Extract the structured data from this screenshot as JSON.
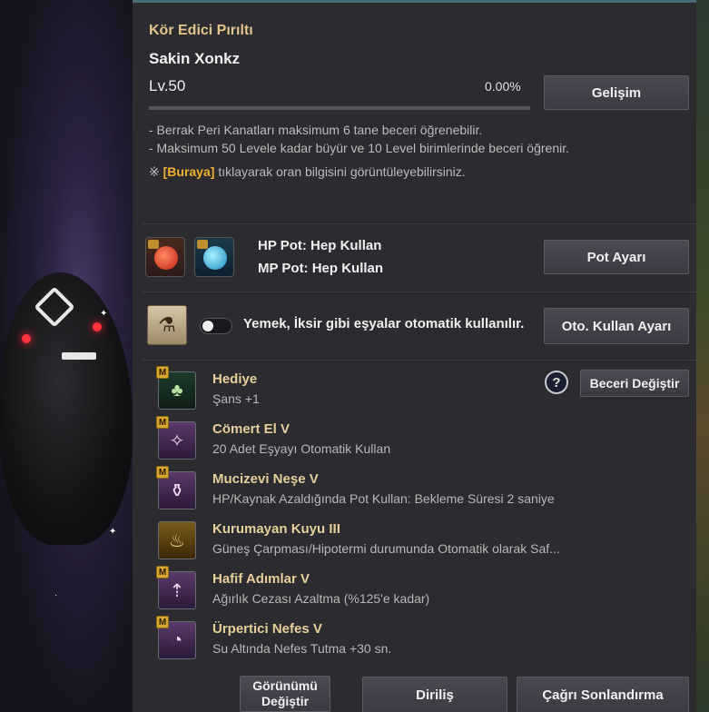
{
  "header": {
    "title": "Kör Edici Pırıltı",
    "pet_name": "Sakin Xonkz",
    "level": "Lv.50",
    "percent": "0.00%",
    "upgrade_button": "Gelişim",
    "xp_progress": 0
  },
  "info": {
    "line1": "- Berrak Peri Kanatları maksimum 6 tane beceri öğrenebilir.",
    "line2": "- Maksimum 50 Levele kadar büyür ve 10 Level birimlerinde beceri öğrenir.",
    "line3_prefix": "※",
    "line3_link": "[Buraya]",
    "line3_suffix": "tıklayarak oran bilgisini görüntüleyebilirsiniz."
  },
  "potions": {
    "hp_label": "HP Pot: Hep Kullan",
    "mp_label": "MP Pot: Hep Kullan",
    "settings_button": "Pot Ayarı"
  },
  "auto_use": {
    "text": "Yemek, İksir gibi eşyalar otomatik kullanılır.",
    "settings_button": "Oto. Kullan Ayarı",
    "toggle_on": false
  },
  "skills": {
    "help_label": "?",
    "change_button": "Beceri Değiştir",
    "items": [
      {
        "name": "Hediye",
        "desc": "Şans +1",
        "badge": "M",
        "icon": "clover-icon"
      },
      {
        "name": "Cömert El V",
        "desc": "20 Adet Eşyayı Otomatik Kullan",
        "badge": "M",
        "icon": "fairy-icon"
      },
      {
        "name": "Mucizevi Neşe V",
        "desc": "HP/Kaynak Azaldığında Pot Kullan: Bekleme Süresi 2 saniye",
        "badge": "M",
        "icon": "potion-plus-icon"
      },
      {
        "name": "Kurumayan Kuyu III",
        "desc": "Güneş Çarpması/Hipotermi durumunda Otomatik olarak Saf...",
        "badge": "",
        "icon": "bowl-icon"
      },
      {
        "name": "Hafif Adımlar V",
        "desc": "Ağırlık Cezası Azaltma (%125'e kadar)",
        "badge": "M",
        "icon": "weight-icon"
      },
      {
        "name": "Ürpertici Nefes V",
        "desc": "Su Altında Nefes Tutma +30 sn.",
        "badge": "M",
        "icon": "bubble-icon"
      }
    ]
  },
  "footer": {
    "appearance_button_line1": "Görünümü",
    "appearance_button_line2": "Değiştir",
    "revive_button": "Diriliş",
    "dismiss_button": "Çağrı Sonlandırma"
  },
  "colors": {
    "accent_gold": "#e2c58e",
    "panel_bg": "#2b2b30",
    "link_gold": "#f0b030"
  }
}
